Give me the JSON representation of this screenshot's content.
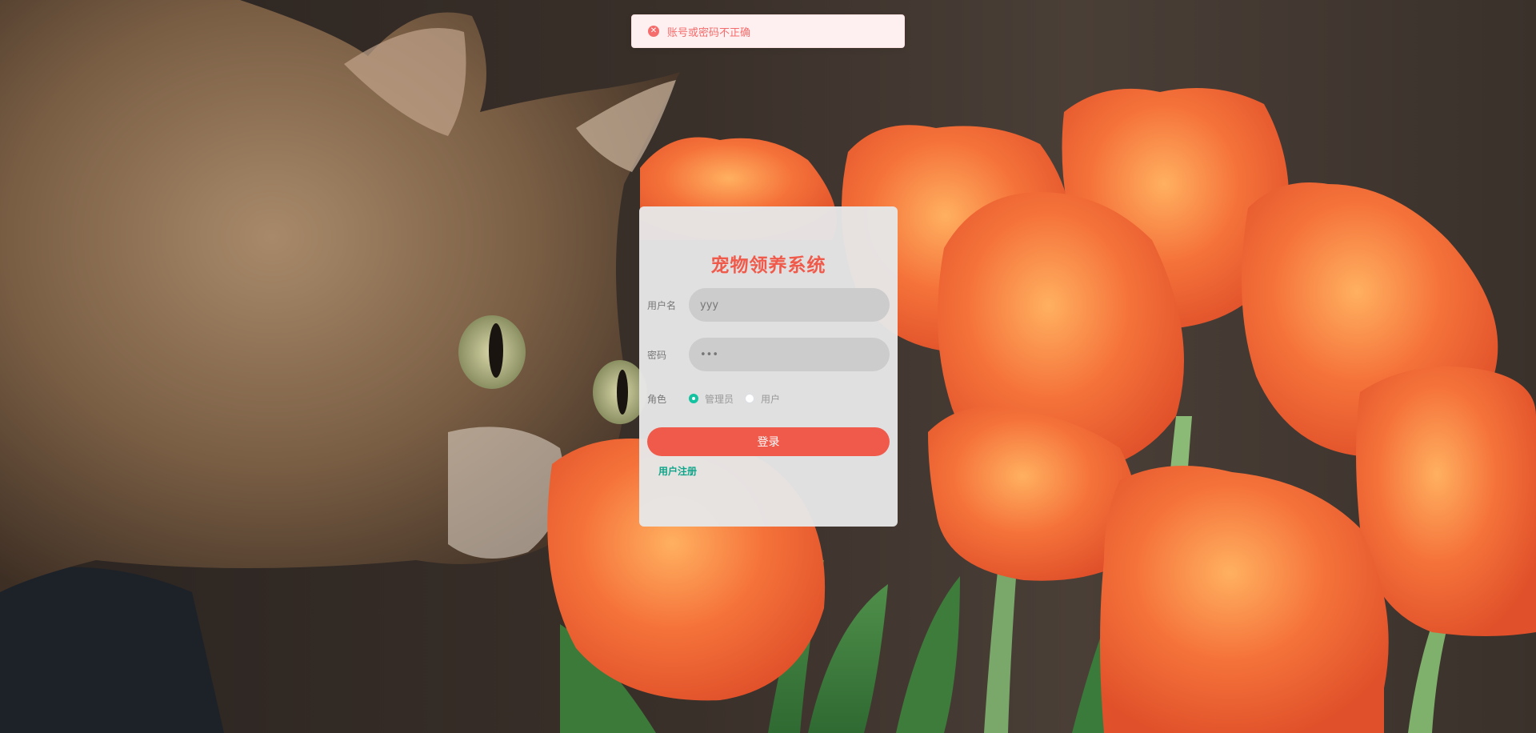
{
  "toast": {
    "icon": "error-circle-icon",
    "message": "账号或密码不正确",
    "color": "#f56c6c"
  },
  "login": {
    "title": "宠物领养系统",
    "username_label": "用户名",
    "username_value": "yyy",
    "password_label": "密码",
    "password_value": "•••",
    "role_label": "角色",
    "roles": [
      {
        "label": "管理员",
        "checked": true
      },
      {
        "label": "用户",
        "checked": false
      }
    ],
    "login_button": "登录",
    "register_link": "用户注册",
    "accent_color": "#f05a4b",
    "link_color": "#10a58a"
  },
  "background": {
    "description_icon": "cat-and-tulips-photo"
  }
}
